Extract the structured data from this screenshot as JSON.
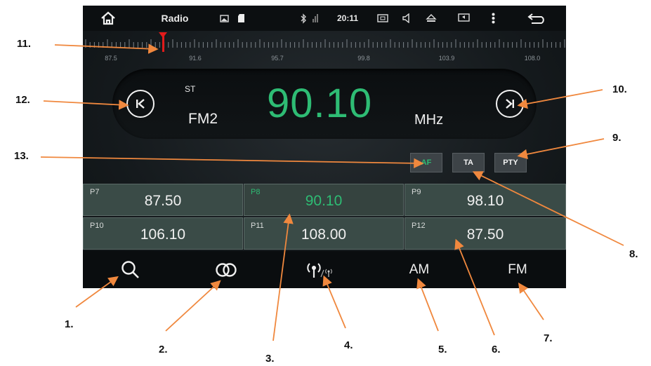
{
  "status_bar": {
    "title": "Radio",
    "time": "20:11",
    "icons": [
      "home-icon",
      "gallery-icon",
      "sd-card-icon",
      "bluetooth-icon",
      "signal-icon",
      "screenshot-icon",
      "volume-icon",
      "eject-icon",
      "display-icon",
      "menu-dots-icon",
      "back-icon"
    ]
  },
  "tuner_scale": {
    "labels": [
      "87.5",
      "91.6",
      "95.7",
      "99.8",
      "103.9",
      "108.0"
    ],
    "needle_icon": "needle-icon"
  },
  "display": {
    "stereo": "ST",
    "band": "FM2",
    "frequency": "90.10",
    "unit": "MHz",
    "prev_icon": "skip-previous-icon",
    "next_icon": "skip-next-icon"
  },
  "options": [
    {
      "label": "AF",
      "active": true
    },
    {
      "label": "TA",
      "active": false
    },
    {
      "label": "PTY",
      "active": false
    }
  ],
  "presets": [
    {
      "num": "P7",
      "freq": "87.50",
      "active": false
    },
    {
      "num": "P8",
      "freq": "90.10",
      "active": true
    },
    {
      "num": "P9",
      "freq": "98.10",
      "active": false
    },
    {
      "num": "P10",
      "freq": "106.10",
      "active": false
    },
    {
      "num": "P11",
      "freq": "108.00",
      "active": false
    },
    {
      "num": "P12",
      "freq": "87.50",
      "active": false
    }
  ],
  "bottom_bar": {
    "search_icon": "search-icon",
    "stereo_icon": "stereo-icon",
    "antenna_icon": "antenna-icon",
    "am_label": "AM",
    "fm_label": "FM"
  },
  "callouts": [
    "1.",
    "2.",
    "3.",
    "4.",
    "5.",
    "6.",
    "7.",
    "8.",
    "9.",
    "10.",
    "11.",
    "12.",
    "13."
  ],
  "colors": {
    "accent_green": "#2ebc74",
    "needle_red": "#e21b1b",
    "arrow_orange": "#f0883e",
    "preset_bg": "#3a4b47"
  }
}
